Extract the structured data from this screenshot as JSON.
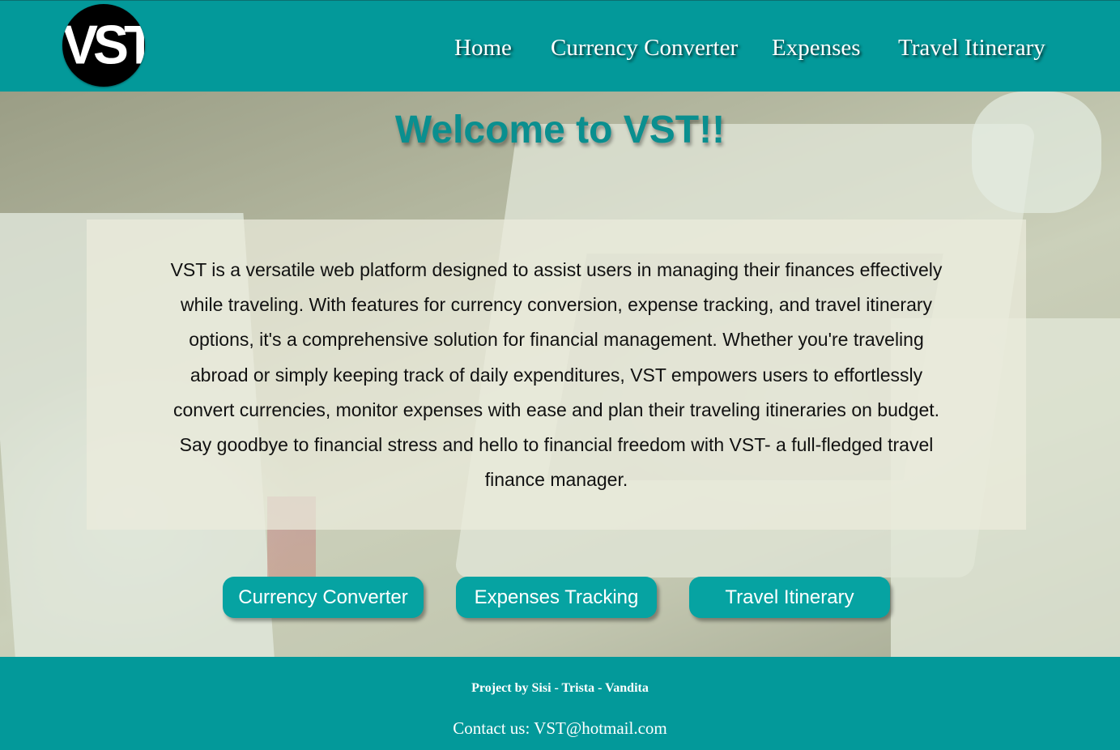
{
  "header": {
    "logo_text": "VST",
    "nav": [
      {
        "label": "Home"
      },
      {
        "label": "Currency Converter"
      },
      {
        "label": "Expenses"
      },
      {
        "label": "Travel Itinerary"
      }
    ]
  },
  "hero": {
    "title": "Welcome to VST!!",
    "description": "VST is a versatile web platform designed to assist users in managing their finances effectively while traveling. With features for currency conversion, expense tracking, and travel itinerary options, it's a comprehensive solution for financial management. Whether you're traveling abroad or simply keeping track of daily expenditures, VST empowers users to effortlessly convert currencies, monitor expenses with ease and plan their traveling itineraries on budget. Say goodbye to financial stress and hello to financial freedom with VST- a full-fledged travel finance manager.",
    "buttons": [
      {
        "label": "Currency Converter"
      },
      {
        "label": "Expenses Tracking"
      },
      {
        "label": "Travel Itinerary"
      }
    ]
  },
  "footer": {
    "credit": "Project by Sisi - Trista - Vandita",
    "contact": "Contact us: VST@hotmail.com"
  },
  "colors": {
    "teal": "#03999a",
    "button": "#06a3a2",
    "title": "#0a8f8f"
  }
}
